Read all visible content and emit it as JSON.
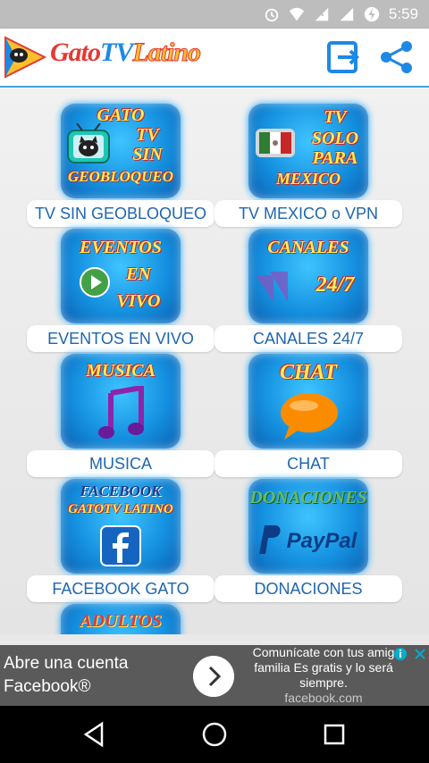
{
  "status": {
    "time": "5:59"
  },
  "app": {
    "title_parts": [
      "Gato",
      "TV",
      "Latino"
    ]
  },
  "tiles": [
    {
      "label": "TV SIN GEOBLOQUEO",
      "caption": [
        "GATO",
        "TV",
        "SIN",
        "GEOBLOQUEO"
      ]
    },
    {
      "label": "TV MEXICO o VPN",
      "caption": [
        "TV",
        "SOLO",
        "PARA",
        "MEXICO"
      ]
    },
    {
      "label": "EVENTOS EN VIVO",
      "caption": [
        "EVENTOS",
        "EN",
        "VIVO"
      ]
    },
    {
      "label": "CANALES 24/7",
      "caption": [
        "CANALES",
        "24/7"
      ]
    },
    {
      "label": "MUSICA",
      "caption": [
        "MUSICA"
      ]
    },
    {
      "label": "CHAT",
      "caption": [
        "CHAT"
      ]
    },
    {
      "label": "FACEBOOK GATO",
      "caption": [
        "FACEBOOK",
        "GATOTV LATINO"
      ]
    },
    {
      "label": "DONACIONES",
      "caption": [
        "DONACIONES",
        "PayPal"
      ]
    },
    {
      "caption": [
        "ADULTOS"
      ]
    }
  ],
  "ad": {
    "line1": "Abre una cuenta",
    "line2": "Facebook®",
    "text": "Comunícate con tus amig",
    "text2": "familia Es gratis y lo será",
    "text3": "siempre.",
    "url": "facebook.com"
  },
  "colors": {
    "accent": "#3da3e0",
    "tile_blue": "#1591e0",
    "label_blue": "#1e66b0"
  }
}
